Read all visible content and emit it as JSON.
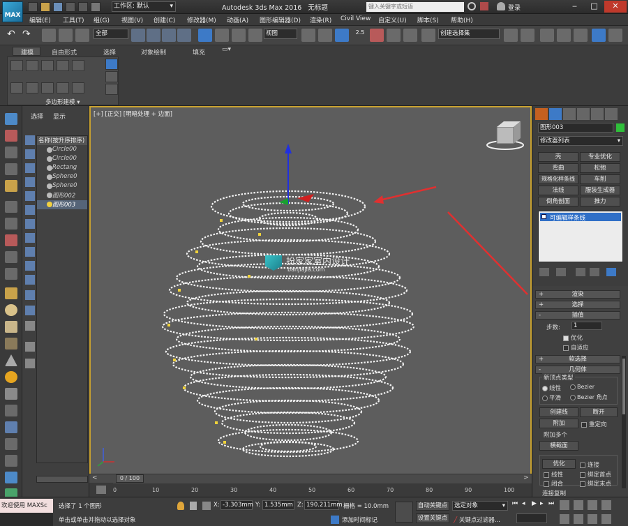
{
  "app": {
    "logo_label": "MAX",
    "workspace_label": "工作区: 默认",
    "window_title": "Autodesk 3ds Max 2016",
    "doc_title": "无标题",
    "search_placeholder": "键入关键字或短语",
    "login": "登录"
  },
  "menu": [
    "编辑(E)",
    "工具(T)",
    "组(G)",
    "视图(V)",
    "创建(C)",
    "修改器(M)",
    "动画(A)",
    "图形编辑器(D)",
    "渲染(R)",
    "Civil View",
    "自定义(U)",
    "脚本(S)",
    "帮助(H)"
  ],
  "toolbar": {
    "filter_value": "全部",
    "coord_value": "视图",
    "snap_value": "2.5",
    "selection_set_value": "创建选择集"
  },
  "ribbon": {
    "tabs": [
      "建模",
      "自由形式",
      "选择",
      "对象绘制",
      "填充"
    ],
    "panel_label": "多边形建模"
  },
  "scene_explorer": {
    "tabs": [
      "选择",
      "显示"
    ],
    "header": "名称(按升序排序)",
    "items": [
      "Circle00",
      "Circle00",
      "Rectang",
      "Sphere0",
      "Sphere0",
      "图形002",
      "图形003"
    ]
  },
  "viewport": {
    "label": "[+] [正交] [明暗处理 + 边面]",
    "watermark_text": "扮家家室内设计",
    "watermark_url": "banjiajia.com"
  },
  "command_panel": {
    "object_name": "图形003",
    "modifier_list": "修改器列表",
    "modifier_buttons": [
      "壳",
      "专业优化",
      "弯曲",
      "松弛",
      "规格化样条线",
      "车削",
      "法线",
      "服装生成器",
      "倒角剖面",
      "推力"
    ],
    "stack_item": "可编辑样条线",
    "rollouts": {
      "render": "渲染",
      "select": "选择",
      "interp": "插值",
      "soft_select": "软选择",
      "geometry": "几何体"
    },
    "interpolation": {
      "steps_label": "步数:",
      "steps_value": "1",
      "optimize_label": "优化",
      "adaptive_label": "自适应"
    },
    "geometry": {
      "new_vertex_type_label": "新顶点类型",
      "linear_label": "线性",
      "bezier_label": "Bezier",
      "smooth_label": "平滑",
      "bezier_corner_label": "Bezier 角点",
      "create_line": "创建线",
      "break": "断开",
      "attach": "附加",
      "reorient": "重定向",
      "attach_multi": "附加多个",
      "cross_section": "横截面",
      "optimize": "优化",
      "connect": "连接",
      "linear2": "线性",
      "bind_first": "绑定首点",
      "closed": "闭合",
      "bind_last": "绑定末点",
      "connect_copy": "连接复制"
    }
  },
  "timeline": {
    "frame_display": "0 / 100",
    "ticks": [
      "0",
      "10",
      "20",
      "30",
      "40",
      "50",
      "60",
      "70",
      "80",
      "90",
      "100"
    ]
  },
  "status": {
    "welcome": "欢迎使用 MAXSc",
    "selected": "选择了 1 个图形",
    "hint": "单击或单击并拖动以选择对象",
    "x_label": "X:",
    "x_value": "-3.303mm",
    "y_label": "Y:",
    "y_value": "1.535mm",
    "z_label": "Z:",
    "z_value": "190.211mm",
    "grid": "栅格 = 10.0mm",
    "auto_key": "自动关键点",
    "set_key": "设置关键点",
    "selected_objects": "选定对象",
    "key_filters": "关键点过滤器...",
    "add_time_tag": "添加时间标记"
  }
}
